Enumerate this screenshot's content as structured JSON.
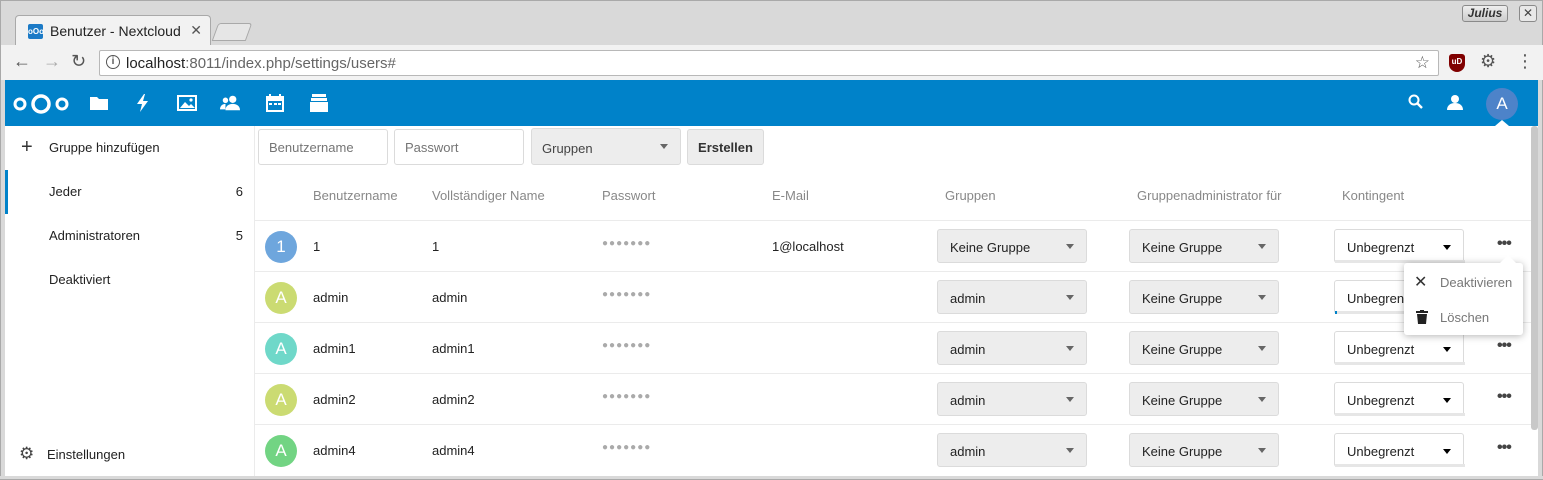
{
  "browser": {
    "tab_title": "Benutzer - Nextcloud",
    "user_badge": "Julius",
    "url_host": "localhost",
    "url_rest": ":8011/index.php/settings/users#",
    "ublock_label": "uD"
  },
  "header": {
    "avatar_letter": "A",
    "accent": "#0082c9"
  },
  "sidebar": {
    "add_group": "Gruppe hinzufügen",
    "items": [
      {
        "label": "Jeder",
        "count": "6"
      },
      {
        "label": "Administratoren",
        "count": "5"
      },
      {
        "label": "Deaktiviert",
        "count": ""
      }
    ],
    "settings": "Einstellungen"
  },
  "new_user": {
    "username_placeholder": "Benutzername",
    "password_placeholder": "Passwort",
    "groups_select": "Gruppen",
    "create_button": "Erstellen"
  },
  "table": {
    "headers": [
      "Benutzername",
      "Vollständiger Name",
      "Passwort",
      "E-Mail",
      "Gruppen",
      "Gruppenadministrator für",
      "Kontingent"
    ],
    "password_mask": "●●●●●●●",
    "rows": [
      {
        "avatar": "1",
        "avatar_color": "#6ea6dd",
        "username": "1",
        "fullname": "1",
        "email": "1@localhost",
        "groups": "Keine Gruppe",
        "admin_for": "Keine Gruppe",
        "quota": "Unbegrenzt"
      },
      {
        "avatar": "A",
        "avatar_color": "#cbdb72",
        "username": "admin",
        "fullname": "admin",
        "email": "",
        "groups": "admin",
        "admin_for": "Keine Gruppe",
        "quota": "Unbegrenzt"
      },
      {
        "avatar": "A",
        "avatar_color": "#6fd8c9",
        "username": "admin1",
        "fullname": "admin1",
        "email": "",
        "groups": "admin",
        "admin_for": "Keine Gruppe",
        "quota": "Unbegrenzt"
      },
      {
        "avatar": "A",
        "avatar_color": "#cbdb72",
        "username": "admin2",
        "fullname": "admin2",
        "email": "",
        "groups": "admin",
        "admin_for": "Keine Gruppe",
        "quota": "Unbegrenzt"
      },
      {
        "avatar": "A",
        "avatar_color": "#72d483",
        "username": "admin4",
        "fullname": "admin4",
        "email": "",
        "groups": "admin",
        "admin_for": "Keine Gruppe",
        "quota": "Unbegrenzt"
      }
    ]
  },
  "popover": {
    "items": [
      {
        "icon": "close-icon",
        "label": "Deaktivieren"
      },
      {
        "icon": "trash-icon",
        "label": "Löschen"
      }
    ]
  }
}
